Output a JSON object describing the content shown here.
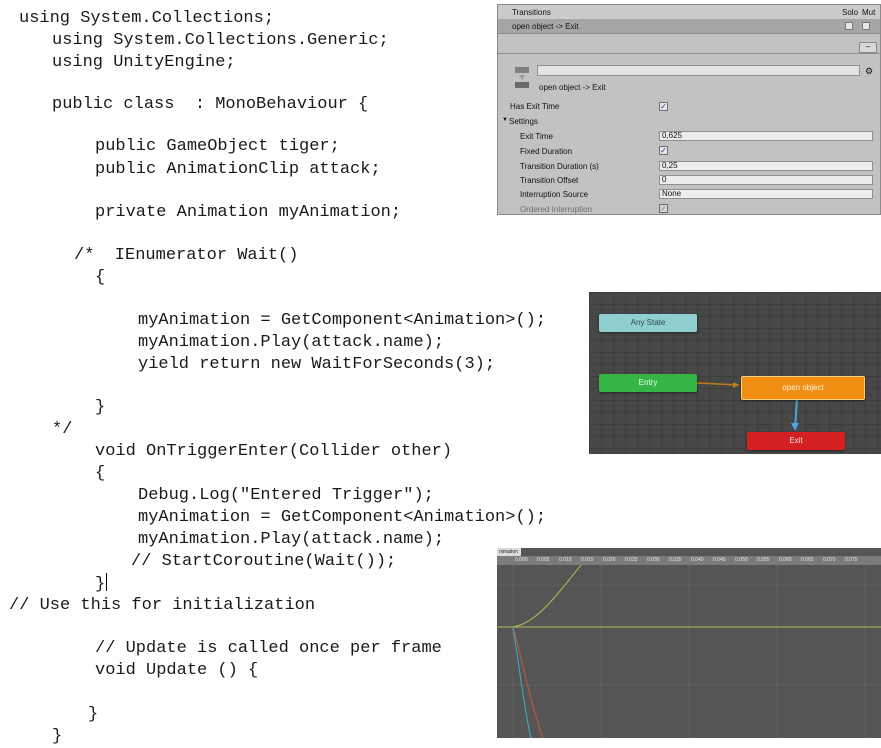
{
  "code": {
    "lines": [
      "using System.Collections;",
      "using System.Collections.Generic;",
      "using UnityEngine;",
      "public class  : MonoBehaviour {",
      "public GameObject tiger;",
      "public AnimationClip attack;",
      "private Animation myAnimation;",
      "/*  IEnumerator Wait()",
      "{",
      "myAnimation = GetComponent<Animation>();",
      "myAnimation.Play(attack.name);",
      "yield return new WaitForSeconds(3);",
      "}",
      "*/",
      "void OnTriggerEnter(Collider other)",
      "{",
      "Debug.Log(\"Entered Trigger\");",
      "myAnimation = GetComponent<Animation>();",
      "myAnimation.Play(attack.name);",
      "// StartCoroutine(Wait());",
      "}",
      "// Use this for initialization",
      "// Update is called once per frame",
      "void Update () {",
      "}",
      "}"
    ]
  },
  "inspector": {
    "transitions_label": "Transitions",
    "solo_label": "Solo",
    "mute_label": "Mut",
    "transition_item": "open object -> Exit",
    "minus_label": "–",
    "name_subtitle": "open object -> Exit",
    "has_exit_time_label": "Has Exit Time",
    "settings_label": "Settings",
    "exit_time_label": "Exit Time",
    "exit_time_value": "0,625",
    "fixed_duration_label": "Fixed Duration",
    "transition_duration_label": "Transition Duration (s)",
    "transition_duration_value": "0,25",
    "transition_offset_label": "Transition Offset",
    "transition_offset_value": "0",
    "interruption_source_label": "Interruption Source",
    "interruption_source_value": "None",
    "ordered_interruption_label": "Ordered Interruption",
    "checkmark": "✓",
    "settings_arrow": "▼",
    "gear": "⚙"
  },
  "animator": {
    "any_state": "Any State",
    "entry": "Entry",
    "open_object": "open object",
    "exit": "Exit"
  },
  "curves": {
    "tab_label": "nimation",
    "ruler_labels": [
      "0.000",
      "0.005",
      "0.010",
      "0.015",
      "0.020",
      "0.025",
      "0.030",
      "0.035",
      "0.040",
      "0.045",
      "0.050",
      "0.055",
      "0.060",
      "0.065",
      "0.070",
      "0.075"
    ]
  }
}
